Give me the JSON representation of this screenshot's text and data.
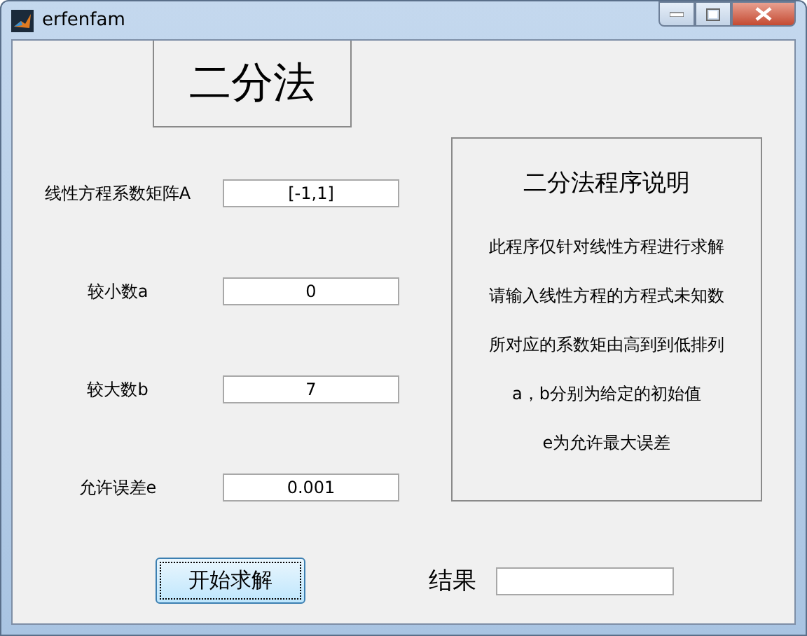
{
  "window": {
    "title": "erfenfam"
  },
  "heading": "二分法",
  "inputs": [
    {
      "label": "线性方程系数矩阵A",
      "value": "[-1,1]"
    },
    {
      "label": "较小数a",
      "value": "0"
    },
    {
      "label": "较大数b",
      "value": "7"
    },
    {
      "label": "允许误差e",
      "value": "0.001"
    }
  ],
  "info_panel": {
    "title": "二分法程序说明",
    "lines": [
      "此程序仅针对线性方程进行求解",
      "请输入线性方程的方程式未知数",
      "所对应的系数矩由高到到低排列",
      "a，b分别为给定的初始值",
      "e为允许最大误差"
    ]
  },
  "solve_button": "开始求解",
  "result": {
    "label": "结果"
  }
}
